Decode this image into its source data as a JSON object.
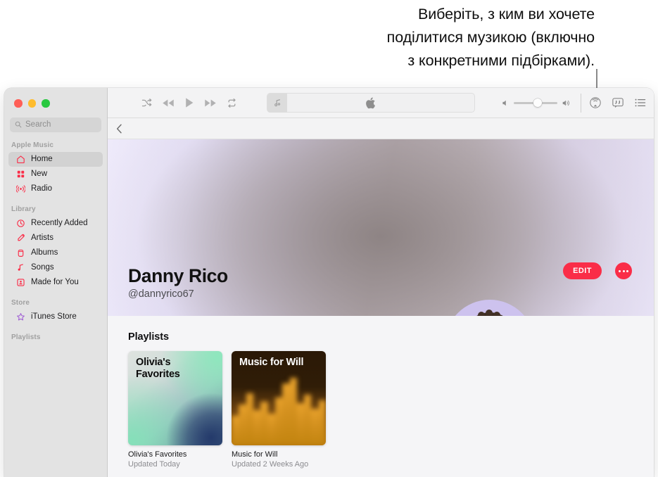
{
  "callout": {
    "lines": [
      "Виберіть, з ким ви хочете",
      "поділитися музикою (включно",
      "з конкретними підбірками)."
    ]
  },
  "sidebar": {
    "search": {
      "placeholder": "Search",
      "icon": "search-icon"
    },
    "groups": [
      {
        "title": "Apple Music",
        "items": [
          {
            "label": "Home",
            "icon": "home-icon",
            "active": true
          },
          {
            "label": "New",
            "icon": "grid-icon",
            "active": false
          },
          {
            "label": "Radio",
            "icon": "radio-broadcast-icon",
            "active": false
          }
        ]
      },
      {
        "title": "Library",
        "items": [
          {
            "label": "Recently Added",
            "icon": "clock-icon",
            "active": false
          },
          {
            "label": "Artists",
            "icon": "microphone-icon",
            "active": false
          },
          {
            "label": "Albums",
            "icon": "album-icon",
            "active": false
          },
          {
            "label": "Songs",
            "icon": "music-note-icon",
            "active": false
          },
          {
            "label": "Made for You",
            "icon": "person-frame-icon",
            "active": false
          }
        ]
      },
      {
        "title": "Store",
        "items": [
          {
            "label": "iTunes Store",
            "icon": "star-icon",
            "active": false
          }
        ]
      },
      {
        "title": "Playlists",
        "items": []
      }
    ]
  },
  "toolbar": {
    "transport": [
      {
        "name": "shuffle-icon"
      },
      {
        "name": "rewind-icon"
      },
      {
        "name": "play-icon"
      },
      {
        "name": "fast-forward-icon"
      },
      {
        "name": "repeat-icon"
      }
    ],
    "now_playing": {
      "artwork_icon": "music-note-icon",
      "logo_icon": "apple-logo-icon"
    },
    "volume": {
      "min_icon": "volume-min-icon",
      "max_icon": "volume-max-icon",
      "level": 50
    },
    "right_icons": [
      {
        "name": "airplay-icon"
      },
      {
        "name": "lyrics-icon"
      },
      {
        "name": "queue-list-icon"
      }
    ]
  },
  "navbar": {
    "back_icon": "chevron-left-icon"
  },
  "profile": {
    "name": "Danny Rico",
    "handle": "@dannyrico67",
    "avatar_icon": "memoji-avatar",
    "edit_label": "EDIT",
    "more_icon": "ellipsis-icon",
    "accent_color": "#fa2d48",
    "avatar_bg_color": "#cdc2ee"
  },
  "content": {
    "section_title": "Playlists",
    "playlists": [
      {
        "art_title": "Olivia's Favorites",
        "name": "Olivia's Favorites",
        "updated": "Updated Today",
        "style": "art-olivia"
      },
      {
        "art_title": "Music for Will",
        "name": "Music for Will",
        "updated": "Updated 2 Weeks Ago",
        "style": "art-will"
      }
    ]
  }
}
